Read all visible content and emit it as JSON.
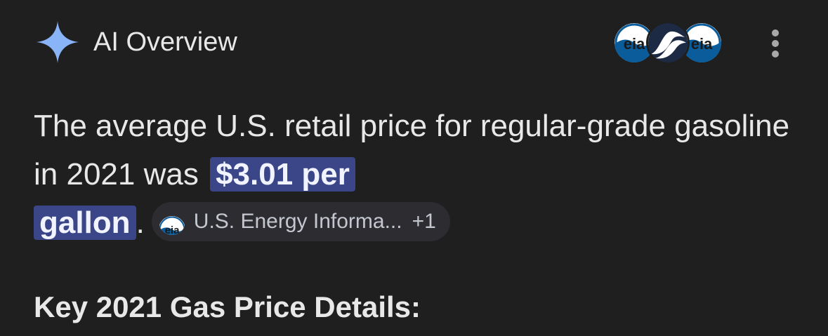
{
  "header": {
    "title": "AI Overview",
    "icon": "sparkle-icon",
    "sources": [
      {
        "name": "eia",
        "logo_text": "eia"
      },
      {
        "name": "eia-wave",
        "logo_text": ""
      },
      {
        "name": "eia",
        "logo_text": "eia"
      }
    ],
    "menu_icon": "more-vert-icon"
  },
  "answer": {
    "text_before": "The average U.S. retail price for regular-grade gasoline in 2021 was",
    "highlight_part1": "$3.01 per",
    "highlight_part2": "gallon",
    "text_after": ".",
    "citation": {
      "logo_text": "eia",
      "label": "U.S. Energy Informa...",
      "extra_count": "+1"
    }
  },
  "section": {
    "heading": "Key 2021 Gas Price Details:"
  },
  "colors": {
    "background": "#1f1f1f",
    "highlight": "#3b4688",
    "chip": "#2c2c31",
    "sparkle": "#8ab4f8",
    "eia_blue": "#0a5c9a"
  }
}
